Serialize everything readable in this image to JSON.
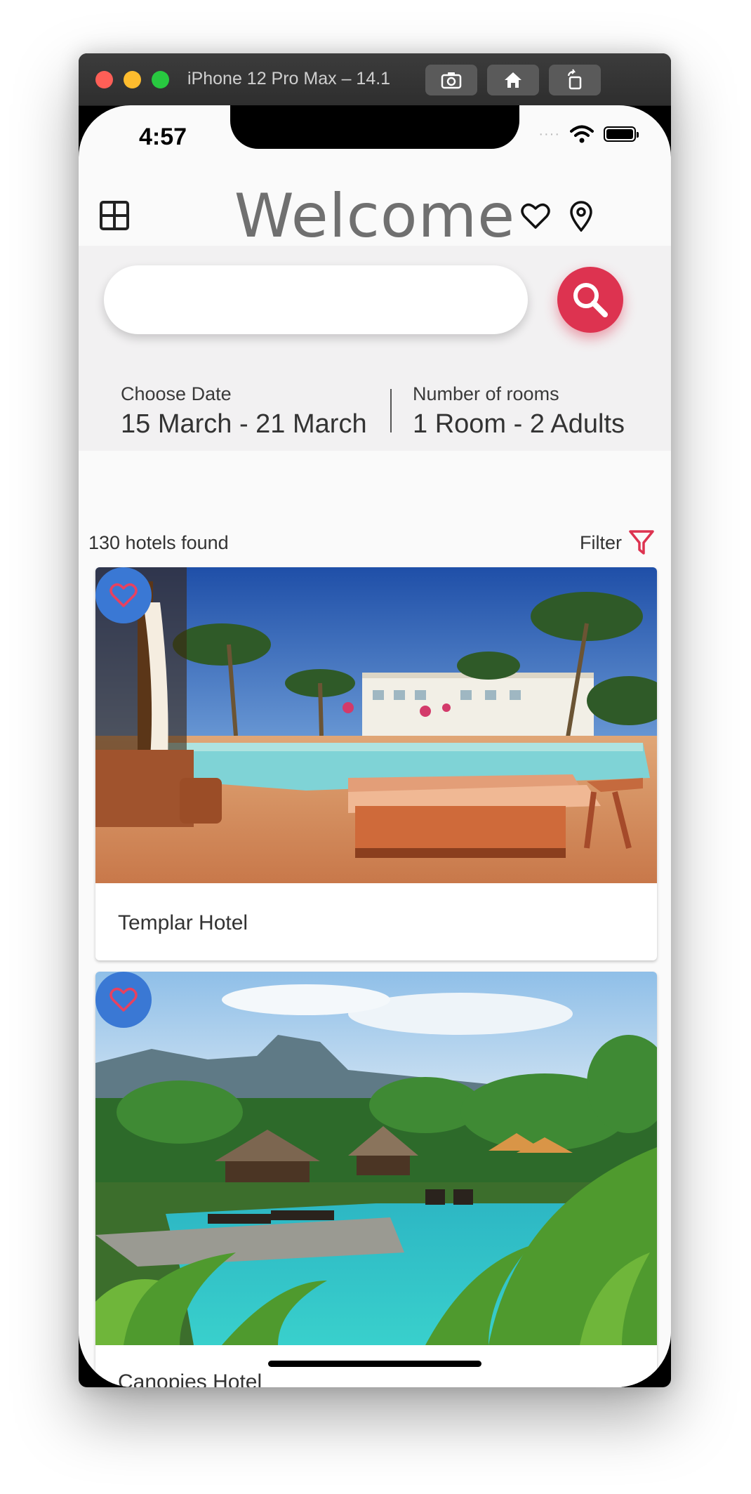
{
  "simulator": {
    "title": "iPhone 12 Pro Max – 14.1",
    "buttons": [
      "screenshot-icon",
      "home-icon",
      "rotate-icon"
    ]
  },
  "status_bar": {
    "time": "4:57",
    "signal": "····",
    "icons": [
      "wifi-icon",
      "battery-icon"
    ]
  },
  "app_bar": {
    "title": "Welcome",
    "icons": [
      "grid-menu-icon",
      "heart-icon",
      "location-pin-icon"
    ]
  },
  "search": {
    "value": "",
    "placeholder": "",
    "button_icon": "search-icon"
  },
  "booking": {
    "date_label": "Choose Date",
    "date_value": "15 March - 21 March",
    "rooms_label": "Number of rooms",
    "rooms_value": "1 Room - 2 Adults"
  },
  "results": {
    "count_text": "130 hotels found",
    "filter_label": "Filter",
    "filter_icon": "filter-funnel-icon"
  },
  "hotels": [
    {
      "name": "Templar Hotel",
      "favorite_icon": "heart-outline-icon"
    },
    {
      "name": "Canopies Hotel",
      "favorite_icon": "heart-outline-icon"
    }
  ],
  "colors": {
    "accent": "#dd3350",
    "favorite_badge": "#3a78d4",
    "title_text": "#707070",
    "search_panel_bg": "#f2f1f2"
  }
}
